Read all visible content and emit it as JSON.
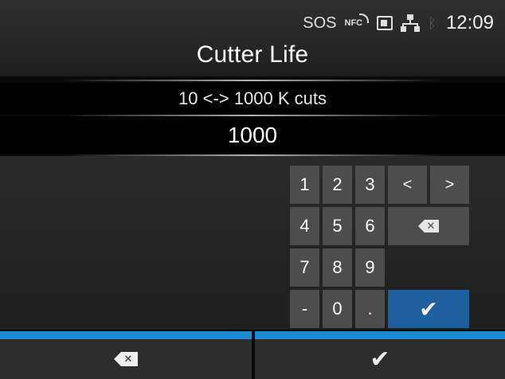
{
  "status": {
    "sos": "SOS",
    "nfc": "NFC",
    "time": "12:09",
    "icons": [
      "nfc-icon",
      "sd-card-icon",
      "lan-icon",
      "bluetooth-icon"
    ]
  },
  "title": "Cutter Life",
  "range_text": "10 <-> 1000 K cuts",
  "value": "1000",
  "keypad": {
    "keys": [
      "1",
      "2",
      "3",
      "<",
      ">",
      "4",
      "5",
      "6",
      "7",
      "8",
      "9",
      "-",
      "0",
      "."
    ],
    "backspace_icon": "backspace-icon",
    "backspace_glyph": "✕",
    "enter_icon": "check-icon",
    "enter_glyph": "✔"
  },
  "softkeys": {
    "left": {
      "icon": "backspace-icon",
      "glyph": "✕"
    },
    "right": {
      "icon": "check-icon",
      "glyph": "✔"
    }
  },
  "colors": {
    "accent": "#1a8ad4",
    "enter_key": "#1e5f9e",
    "key": "#4d4d4d",
    "bluetooth_inactive": "#5a5a5a"
  }
}
